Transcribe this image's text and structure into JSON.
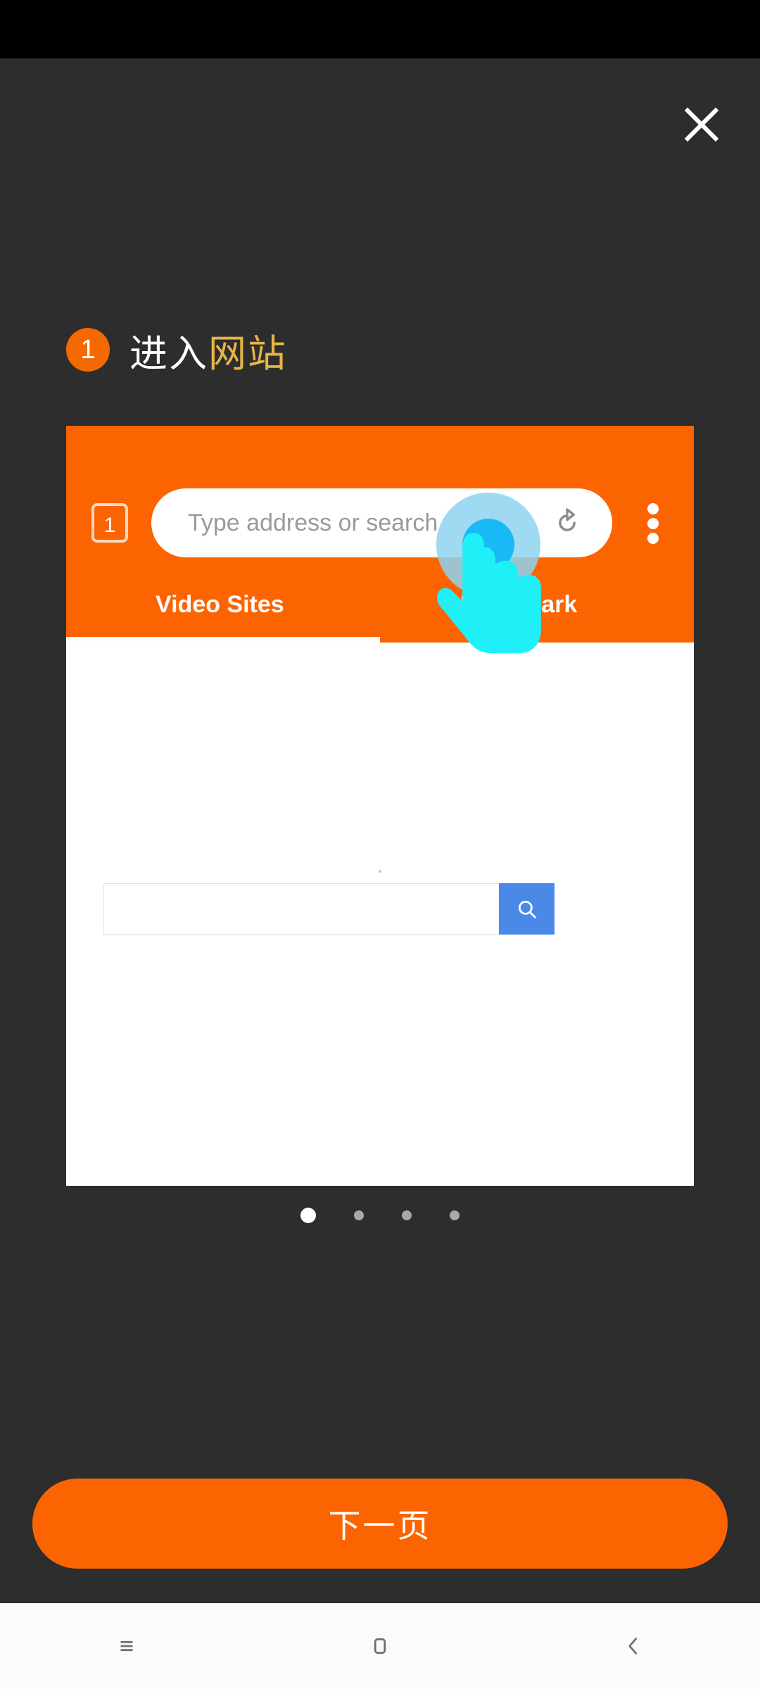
{
  "overlay": {
    "close_icon": "close-icon",
    "step": {
      "number": "1",
      "title_plain": "进入",
      "title_accent": "网站"
    },
    "accent_color": "#fb6400",
    "highlight_color": "#e7b546",
    "background_color": "#2d2d2d"
  },
  "mockup": {
    "tab_count": "1",
    "address_placeholder": "Type address or search",
    "address_value": "",
    "refresh_icon": "refresh-icon",
    "menu_icon": "overflow-menu-icon",
    "tabs": [
      {
        "label": "Video Sites",
        "active": true
      },
      {
        "label": "Bookmark",
        "active": false
      }
    ],
    "page": {
      "search_value": "",
      "search_placeholder": "",
      "search_button_icon": "search-icon",
      "search_button_color": "#4a89e8"
    },
    "cursor_icon": "hand-pointer-icon"
  },
  "carousel": {
    "total": 4,
    "active_index": 0,
    "dots": [
      "active",
      "idle",
      "idle",
      "idle"
    ]
  },
  "footer": {
    "next_label": "下一页"
  },
  "navbar": {
    "items": [
      {
        "name": "recents-icon"
      },
      {
        "name": "home-icon"
      },
      {
        "name": "back-icon"
      }
    ]
  }
}
